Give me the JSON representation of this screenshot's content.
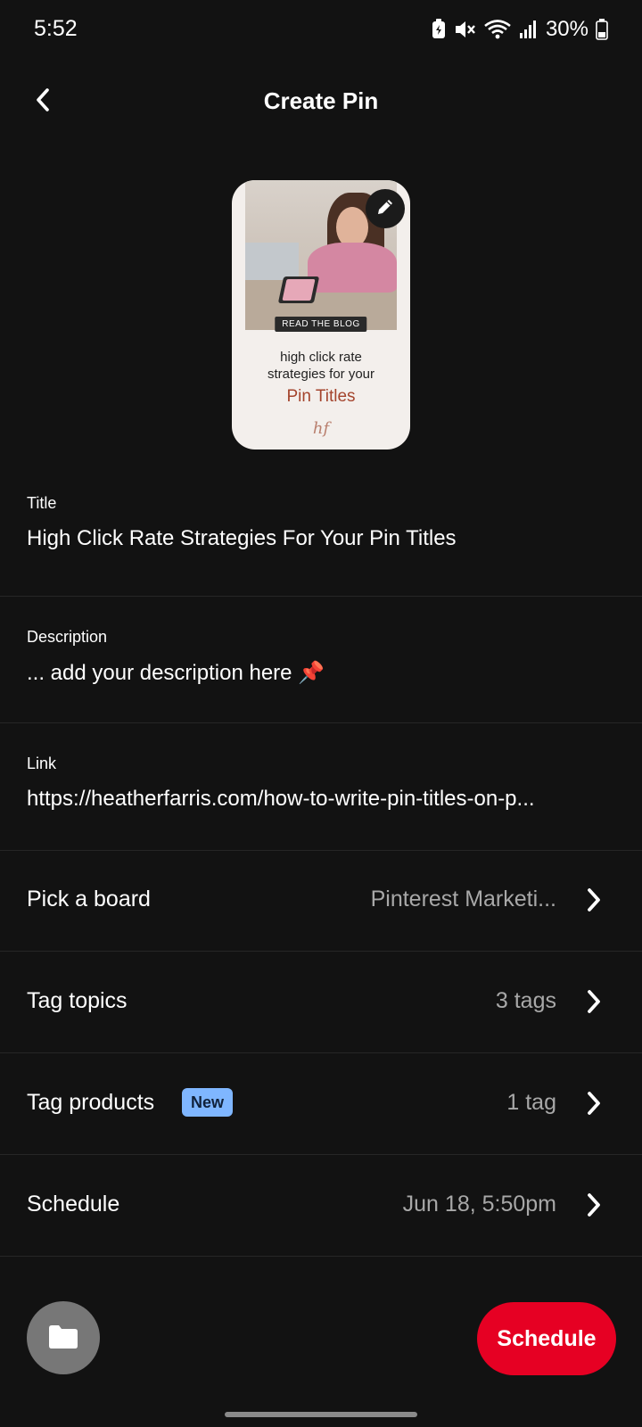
{
  "status_bar": {
    "time": "5:52",
    "battery_percent": "30%"
  },
  "header": {
    "title": "Create Pin"
  },
  "pin_preview": {
    "tag": "READ THE BLOG",
    "line1": "high click rate",
    "line2": "strategies for your",
    "accent": "Pin Titles",
    "logo": "hf"
  },
  "fields": {
    "title": {
      "label": "Title",
      "value": "High Click Rate Strategies For Your Pin Titles"
    },
    "description": {
      "label": "Description",
      "value": "... add your description here 📌"
    },
    "link": {
      "label": "Link",
      "value": "https://heatherfarris.com/how-to-write-pin-titles-on-p..."
    }
  },
  "rows": {
    "board": {
      "label": "Pick a board",
      "value": "Pinterest Marketi..."
    },
    "topics": {
      "label": "Tag topics",
      "value": "3 tags"
    },
    "products": {
      "label": "Tag products",
      "badge": "New",
      "value": "1 tag"
    },
    "schedule": {
      "label": "Schedule",
      "value": "Jun 18, 5:50pm"
    }
  },
  "actions": {
    "schedule_label": "Schedule"
  },
  "colors": {
    "background": "#121212",
    "primary_button": "#e60023",
    "new_badge": "#7fb6ff",
    "secondary_text": "#a8a8a8"
  },
  "icons": [
    "back-arrow-icon",
    "pencil-icon",
    "chevron-right-icon",
    "folder-icon",
    "battery-saver-icon",
    "mute-icon",
    "wifi-icon",
    "signal-icon",
    "battery-icon"
  ]
}
